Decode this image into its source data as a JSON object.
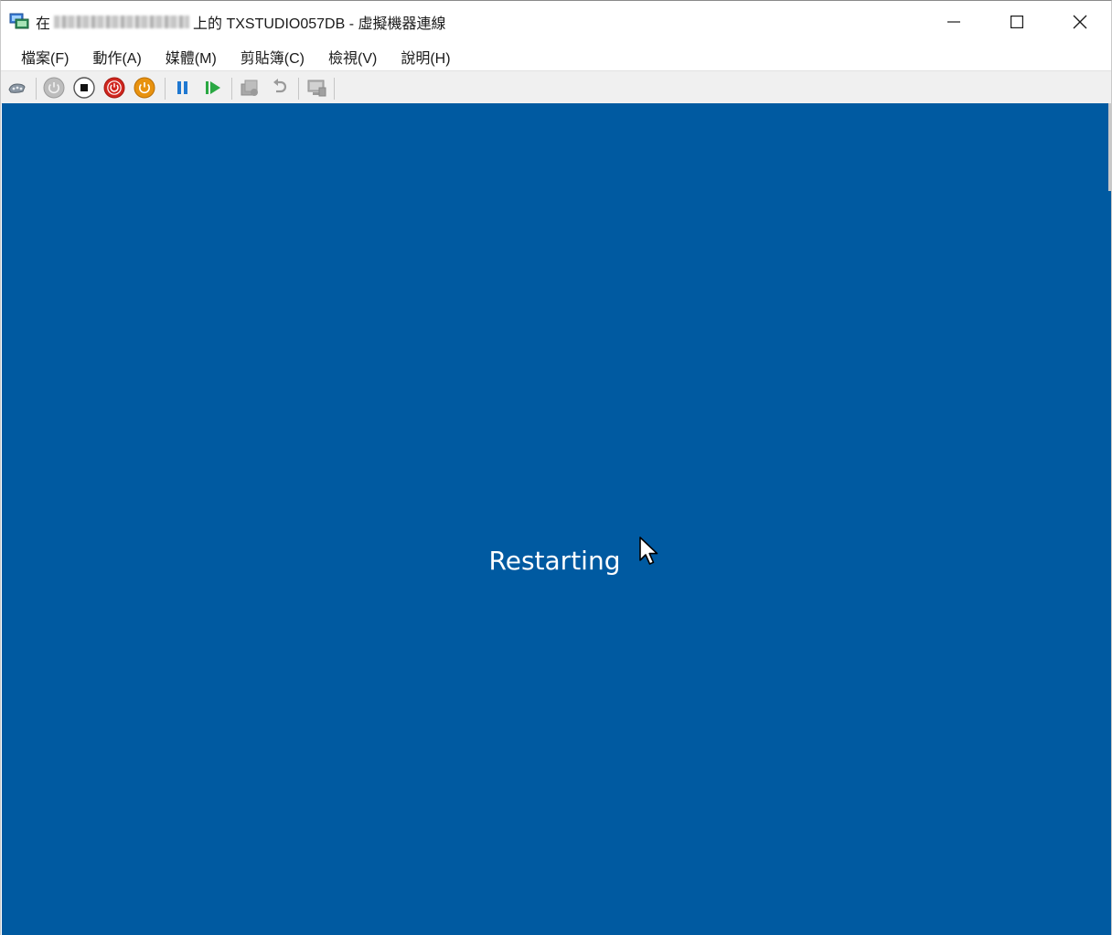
{
  "window": {
    "title_prefix": "在",
    "title_suffix": "上的 TXSTUDIO057DB - 虛擬機器連線"
  },
  "menu": [
    {
      "label": "檔案(F)"
    },
    {
      "label": "動作(A)"
    },
    {
      "label": "媒體(M)"
    },
    {
      "label": "剪貼簿(C)"
    },
    {
      "label": "檢視(V)"
    },
    {
      "label": "說明(H)"
    }
  ],
  "toolbar": {
    "buttons": [
      {
        "icon": "ctrl-alt-del-icon"
      },
      {
        "icon": "start-icon"
      },
      {
        "icon": "turn-off-icon"
      },
      {
        "icon": "shut-down-icon"
      },
      {
        "icon": "save-icon"
      },
      {
        "icon": "pause-icon"
      },
      {
        "icon": "resume-icon"
      },
      {
        "icon": "checkpoint-icon"
      },
      {
        "icon": "revert-icon"
      },
      {
        "icon": "enhanced-session-icon"
      }
    ]
  },
  "vm": {
    "status": "Restarting",
    "background_color": "#005aa1"
  },
  "colors": {
    "vm_blue": "#005aa1",
    "turn_off_red": "#d0261f",
    "save_orange": "#e8920f",
    "pause_blue": "#1f78d1",
    "resume_green": "#2aa843"
  }
}
